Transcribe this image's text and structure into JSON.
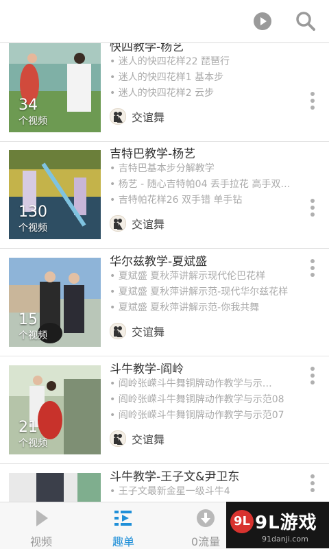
{
  "header": {
    "play_icon": "play-circle-icon",
    "search_icon": "search-icon"
  },
  "playlists": [
    {
      "title": "快四教学-杨艺",
      "count": "34",
      "count_label": "个视频",
      "items": [
        "• 迷人的快四花样22 琵琶行",
        "• 迷人的快四花样1 基本步",
        "• 迷人的快四花样2 云步"
      ],
      "category": "交谊舞"
    },
    {
      "title": "吉特巴教学-杨艺",
      "count": "130",
      "count_label": "个视频",
      "items": [
        "• 吉特巴基本步分解教学",
        "• 杨艺 - 随心吉特帕04 丢手拉花 高手双…",
        "• 吉特帕花样26 双手错 单手钻"
      ],
      "category": "交谊舞"
    },
    {
      "title": "华尔兹教学-夏斌盛",
      "count": "15",
      "count_label": "个视频",
      "items": [
        "• 夏斌盛 夏秋萍讲解示现代伦巴花样",
        "• 夏斌盛 夏秋萍讲解示范-现代华尔兹花样",
        "• 夏斌盛 夏秋萍讲解示范-你我共舞"
      ],
      "category": "交谊舞"
    },
    {
      "title": "斗牛教学-阎岭",
      "count": "21",
      "count_label": "个视频",
      "items": [
        "• 阎岭张嵘斗牛舞铜牌动作教学与示…",
        "• 阎岭张嵘斗牛舞铜牌动作教学与示范08",
        "• 阎岭张嵘斗牛舞铜牌动作教学与示范07"
      ],
      "category": "交谊舞"
    },
    {
      "title": "斗牛教学-王子文&尹卫东",
      "items": [
        "• 王子文最新金星一级斗牛4"
      ]
    }
  ],
  "tabs": [
    {
      "label": "视频",
      "icon": "play-icon",
      "active": false
    },
    {
      "label": "趣单",
      "icon": "playlist-icon",
      "active": true
    },
    {
      "label": "0流量",
      "icon": "download-icon",
      "active": false
    }
  ],
  "watermark": {
    "main": "9L游戏",
    "sub": "91danji.com",
    "logo": "9L"
  },
  "colors": {
    "accent": "#1f8fd8",
    "title": "#333333",
    "subtitle": "#aaaaaa"
  }
}
